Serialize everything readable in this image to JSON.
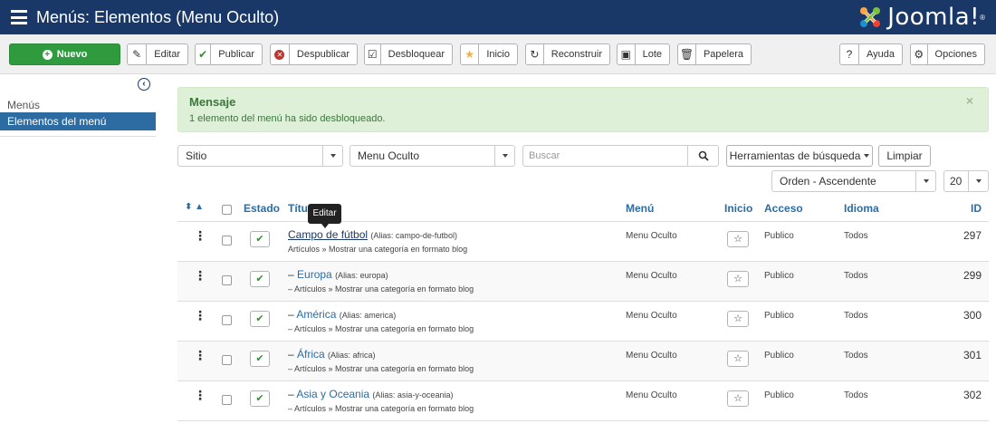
{
  "header": {
    "title": "Menús: Elementos (Menu Oculto)",
    "logo_text": "Joomla!",
    "logo_reg": "®"
  },
  "toolbar": {
    "new": "Nuevo",
    "edit": "Editar",
    "publish": "Publicar",
    "unpublish": "Despublicar",
    "checkin": "Desbloquear",
    "home": "Inicio",
    "rebuild": "Reconstruir",
    "batch": "Lote",
    "trash": "Papelera",
    "help": "Ayuda",
    "options": "Opciones"
  },
  "sidebar": {
    "items": [
      {
        "label": "Menús"
      },
      {
        "label": "Elementos del menú"
      }
    ]
  },
  "alert": {
    "title": "Mensaje",
    "message": "1 elemento del menú ha sido desbloqueado.",
    "close": "×"
  },
  "filters": {
    "site": "Sitio",
    "menu": "Menu Oculto",
    "search_placeholder": "Buscar",
    "tools": "Herramientas de búsqueda",
    "clear": "Limpiar",
    "order": "Orden - Ascendente",
    "limit": "20"
  },
  "table": {
    "headers": {
      "sort": "⬍ ▲",
      "state": "Estado",
      "title": "Títu",
      "menu": "Menú",
      "home": "Inicio",
      "access": "Acceso",
      "language": "Idioma",
      "id": "ID"
    },
    "tooltip": "Editar",
    "rows": [
      {
        "prefix": "",
        "title": "Campo de fútbol",
        "alias": "(Alias: campo-de-futbol)",
        "sub": "Artículos » Mostrar una categoría en formato blog",
        "menu": "Menu Oculto",
        "access": "Publico",
        "language": "Todos",
        "id": "297"
      },
      {
        "prefix": "– ",
        "title": "Europa",
        "alias": "(Alias: europa)",
        "sub": "– Artículos » Mostrar una categoría en formato blog",
        "menu": "Menu Oculto",
        "access": "Publico",
        "language": "Todos",
        "id": "299"
      },
      {
        "prefix": "– ",
        "title": "América",
        "alias": "(Alias: america)",
        "sub": "– Artículos » Mostrar una categoría en formato blog",
        "menu": "Menu Oculto",
        "access": "Publico",
        "language": "Todos",
        "id": "300"
      },
      {
        "prefix": "– ",
        "title": "África",
        "alias": "(Alias: africa)",
        "sub": "– Artículos » Mostrar una categoría en formato blog",
        "menu": "Menu Oculto",
        "access": "Publico",
        "language": "Todos",
        "id": "301"
      },
      {
        "prefix": "– ",
        "title": "Asia y Oceania",
        "alias": "(Alias: asia-y-oceania)",
        "sub": "– Artículos » Mostrar una categoría en formato blog",
        "menu": "Menu Oculto",
        "access": "Publico",
        "language": "Todos",
        "id": "302"
      }
    ]
  },
  "colors": {
    "header_bg": "#1a3867",
    "new_button": "#2f9a3e",
    "sidebar_active": "#2d6ca2",
    "alert_bg": "#dff0d8"
  }
}
